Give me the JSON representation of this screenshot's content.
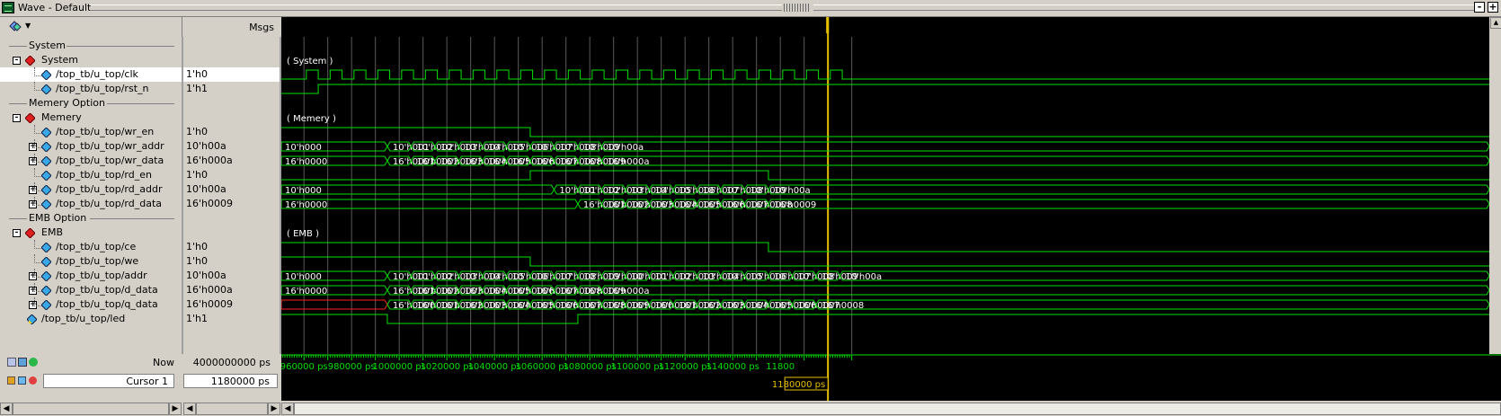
{
  "window": {
    "title": "Wave - Default"
  },
  "header": {
    "msgs_label": "Msgs"
  },
  "rows": [
    {
      "kind": "divider",
      "name": "System"
    },
    {
      "kind": "group",
      "name": "System",
      "wave_label": "System"
    },
    {
      "kind": "signal",
      "name": "/top_tb/u_top/clk",
      "value": "1'h0",
      "highlight": true
    },
    {
      "kind": "signal",
      "name": "/top_tb/u_top/rst_n",
      "value": "1'h1"
    },
    {
      "kind": "divider",
      "name": "Memery Option"
    },
    {
      "kind": "group",
      "name": "Memery",
      "wave_label": "Memery"
    },
    {
      "kind": "signal",
      "name": "/top_tb/u_top/wr_en",
      "value": "1'h0"
    },
    {
      "kind": "bus",
      "name": "/top_tb/u_top/wr_addr",
      "value": "10'h00a"
    },
    {
      "kind": "bus",
      "name": "/top_tb/u_top/wr_data",
      "value": "16'h000a"
    },
    {
      "kind": "signal",
      "name": "/top_tb/u_top/rd_en",
      "value": "1'h0"
    },
    {
      "kind": "bus",
      "name": "/top_tb/u_top/rd_addr",
      "value": "10'h00a"
    },
    {
      "kind": "bus",
      "name": "/top_tb/u_top/rd_data",
      "value": "16'h0009"
    },
    {
      "kind": "divider",
      "name": "EMB Option"
    },
    {
      "kind": "group",
      "name": "EMB",
      "wave_label": "EMB"
    },
    {
      "kind": "signal",
      "name": "/top_tb/u_top/ce",
      "value": "1'h0"
    },
    {
      "kind": "signal",
      "name": "/top_tb/u_top/we",
      "value": "1'h0"
    },
    {
      "kind": "bus",
      "name": "/top_tb/u_top/addr",
      "value": "10'h00a"
    },
    {
      "kind": "bus",
      "name": "/top_tb/u_top/d_data",
      "value": "16'h000a"
    },
    {
      "kind": "bus",
      "name": "/top_tb/u_top/q_data",
      "value": "16'h0009"
    },
    {
      "kind": "output",
      "name": "/top_tb/u_top/led",
      "value": "1'h1"
    }
  ],
  "waves": {
    "wr_addr_labels": [
      "10'h000",
      "10'h001",
      "10'h002",
      "10'h003",
      "10'h004",
      "10'h005",
      "10'h006",
      "10'h007",
      "10'h008",
      "10'h009",
      "10'h00a"
    ],
    "wr_data_labels": [
      "16'h0000",
      "16'h0001",
      "16'h0002",
      "16'h0003",
      "16'h0004",
      "16'h0005",
      "16'h0006",
      "16'h0007",
      "16'h0008",
      "16'h0009",
      "16'h000a"
    ],
    "rd_addr_labels": [
      "10'h000",
      "10'h001",
      "10'h002",
      "10'h003",
      "10'h004",
      "10'h005",
      "10'h006",
      "10'h007",
      "10'h008",
      "10'h009",
      "10'h00a"
    ],
    "rd_data_labels": [
      "16'h0000",
      "16'h0001",
      "16'h0002",
      "16'h0003",
      "16'h0004",
      "16'h0005",
      "16'h0006",
      "16'h0007",
      "16'h0008",
      "16'h0009"
    ],
    "addr_labels": [
      "10'h000",
      "10'h001",
      "10'h002",
      "10'h003",
      "10'h004",
      "10'h005",
      "10'h006",
      "10'h007",
      "10'h008",
      "10'h009",
      "10'h000",
      "10'h001",
      "10'h002",
      "10'h003",
      "10'h004",
      "10'h005",
      "10'h006",
      "10'h007",
      "10'h008",
      "10'h009",
      "10'h00a"
    ],
    "d_data_labels": [
      "16'h0000",
      "16'h0001",
      "16'h0002",
      "16'h0003",
      "16'h0004",
      "16'h0005",
      "16'h0006",
      "16'h0007",
      "16'h0008",
      "16'h0009",
      "16'h000a"
    ],
    "q_data_labels": [
      "16'h0000",
      "16'h0001",
      "16'h0002",
      "16'h0003",
      "16'h0004",
      "16'h0005",
      "16'h0006",
      "16'h0007",
      "16'h0008",
      "16'h0009",
      "16'h0000",
      "16'h0001",
      "16'h0002",
      "16'h0003",
      "16'h0004",
      "16'h0005",
      "16'h0006",
      "16'h0007",
      "16'h0008",
      "16'h0009"
    ]
  },
  "timeline": {
    "ticks": [
      "960000 ps",
      "980000 ps",
      "1000000 ps",
      "1020000 ps",
      "1040000 ps",
      "1060000 ps",
      "1080000 ps",
      "1100000 ps",
      "1120000 ps",
      "1140000 ps",
      "11800"
    ],
    "cursor_label": "1180000 ps"
  },
  "footer": {
    "now_label": "Now",
    "now_value": "4000000000 ps",
    "cursor_name": "Cursor 1",
    "cursor_value": "1180000 ps"
  },
  "colors": {
    "wave": "#00e000",
    "grid": "#5a5a5a",
    "cursor": "#e8c000",
    "text": "#ffffff",
    "unknown": "#ff2020"
  }
}
